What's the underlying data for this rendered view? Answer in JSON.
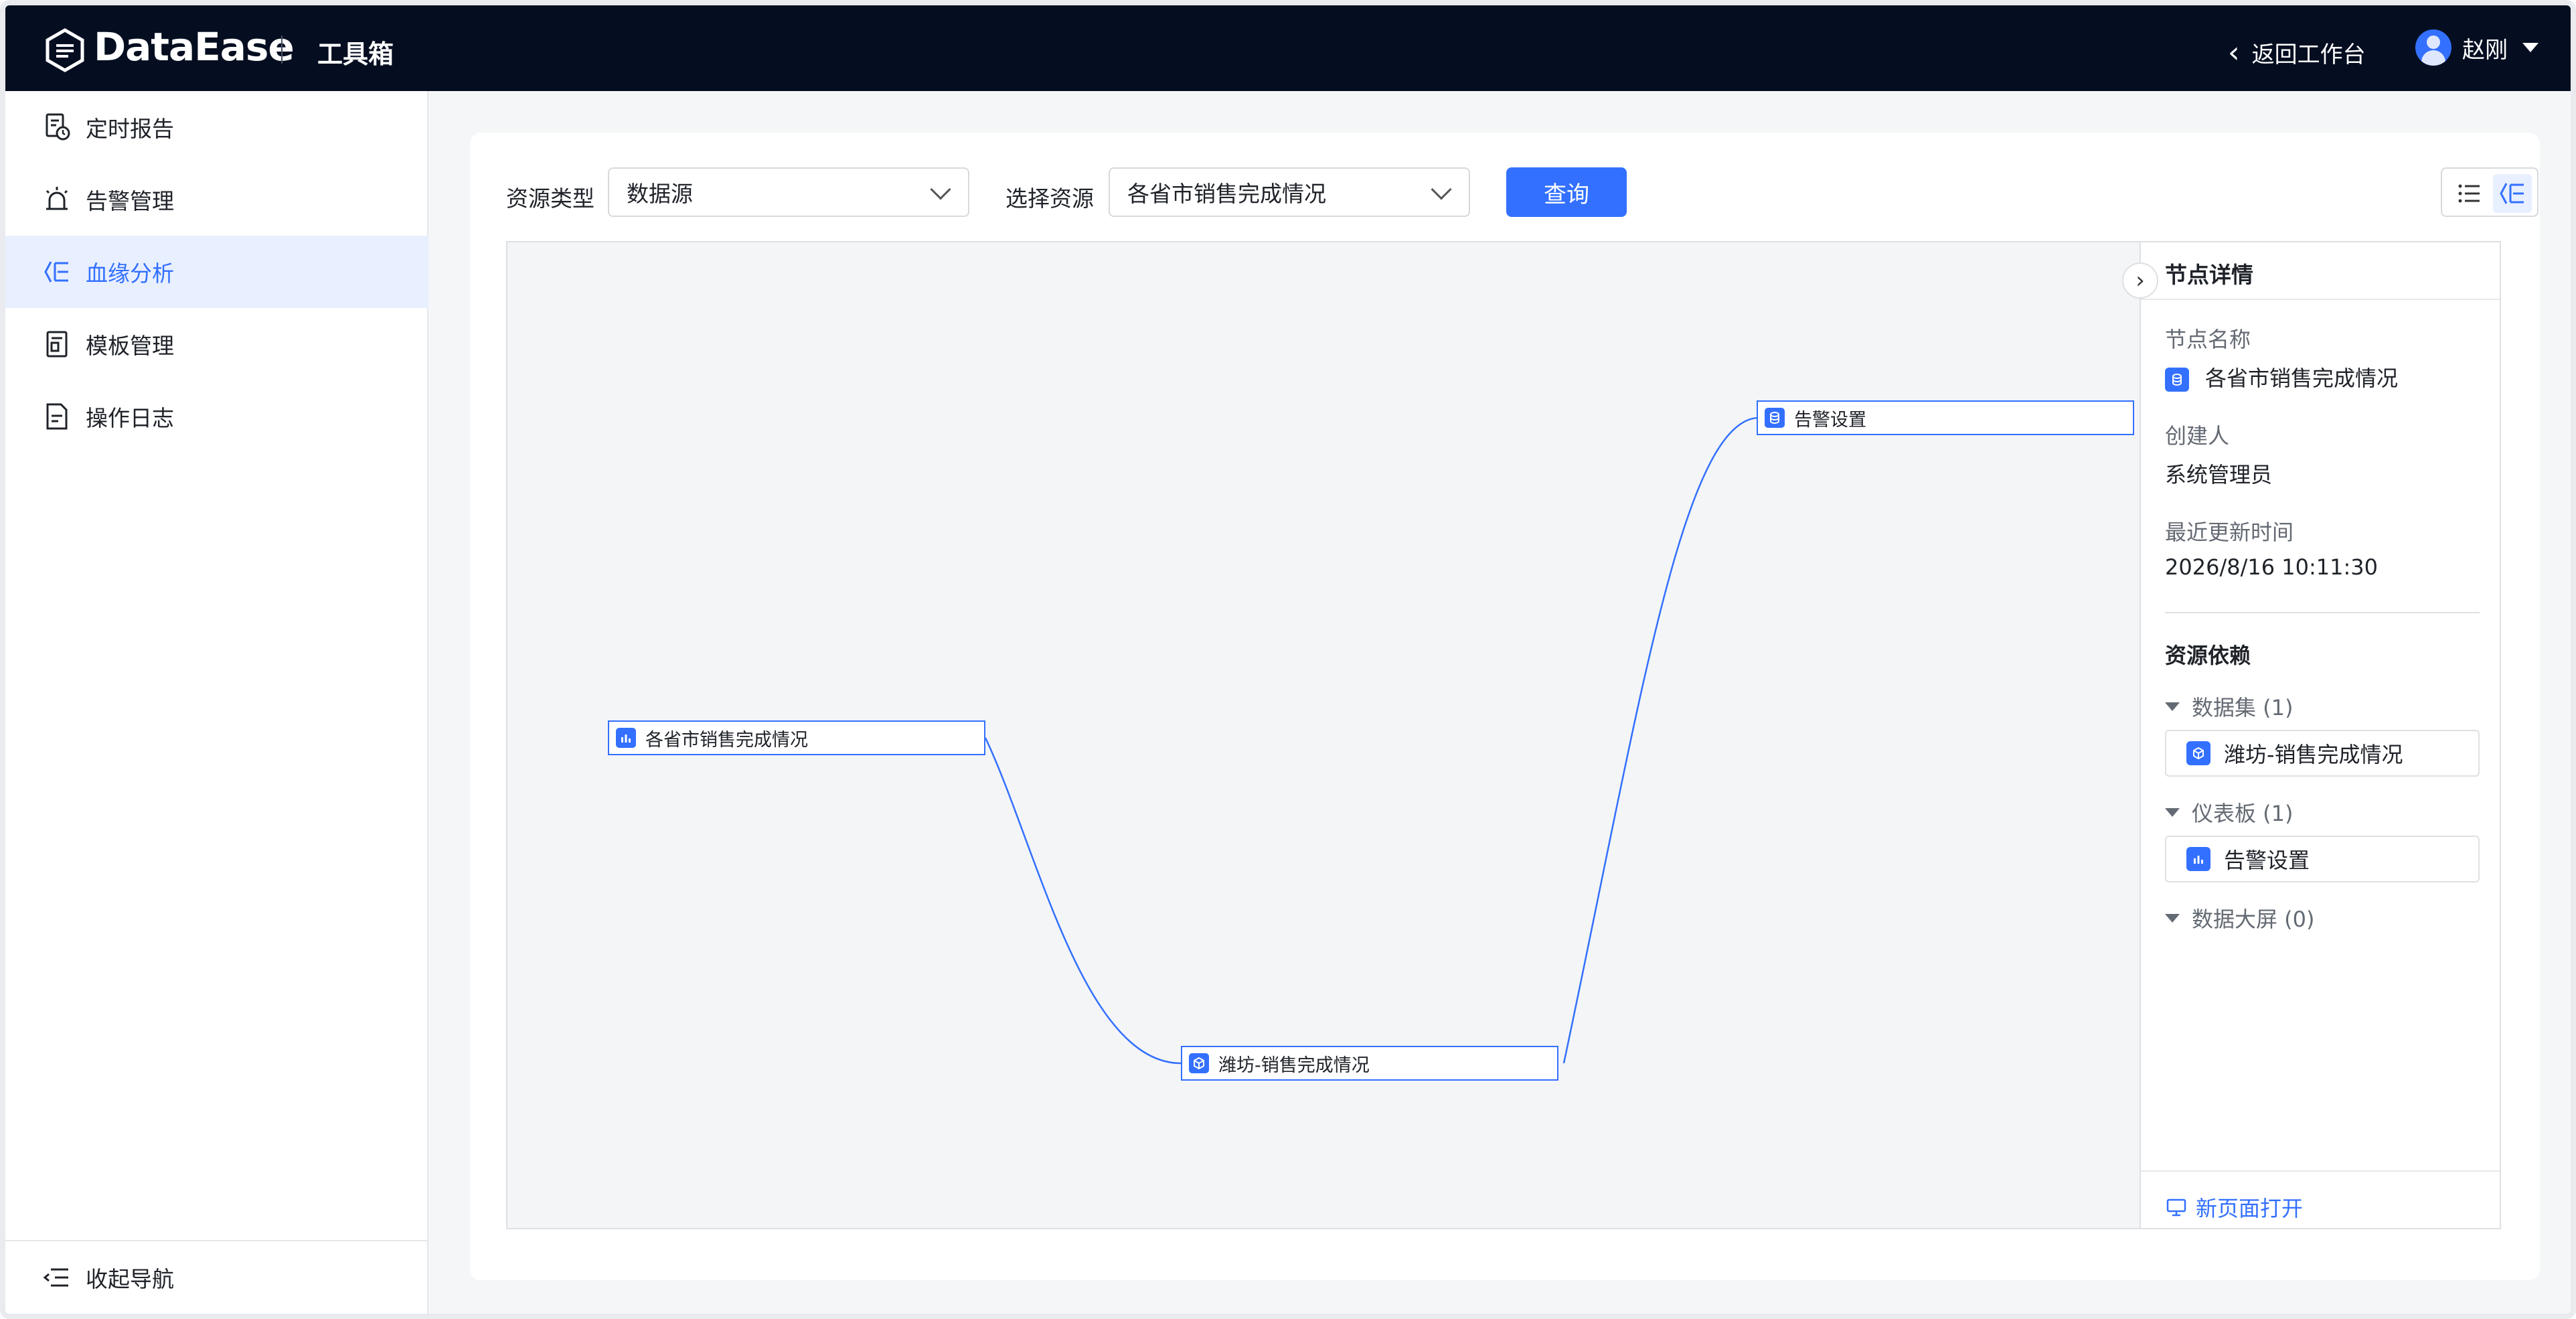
{
  "header": {
    "brand": "DataEase",
    "section": "工具箱",
    "back_label": "返回工作台",
    "user_name": "赵刚"
  },
  "sidebar": {
    "items": [
      {
        "label": "定时报告",
        "icon": "scheduled-report-icon",
        "active": false
      },
      {
        "label": "告警管理",
        "icon": "alarm-icon",
        "active": false
      },
      {
        "label": "血缘分析",
        "icon": "lineage-icon",
        "active": true
      },
      {
        "label": "模板管理",
        "icon": "template-icon",
        "active": false
      },
      {
        "label": "操作日志",
        "icon": "log-icon",
        "active": false
      }
    ],
    "collapse_label": "收起导航"
  },
  "filters": {
    "resource_type_label": "资源类型",
    "resource_type_value": "数据源",
    "resource_label": "选择资源",
    "resource_value": "各省市销售完成情况",
    "query_label": "查询"
  },
  "graph": {
    "nodes": [
      {
        "id": "src",
        "label": "各省市销售完成情况",
        "kind": "datasource"
      },
      {
        "id": "ds",
        "label": "潍坊-销售完成情况",
        "kind": "dataset"
      },
      {
        "id": "dash",
        "label": "告警设置",
        "kind": "dashboard"
      }
    ]
  },
  "panel": {
    "title": "节点详情",
    "name_label": "节点名称",
    "name_value": "各省市销售完成情况",
    "creator_label": "创建人",
    "creator_value": "系统管理员",
    "updated_label": "最近更新时间",
    "updated_value": "2026/8/16 10:11:30",
    "deps_title": "资源依赖",
    "groups": {
      "dataset": {
        "label": "数据集 (1)",
        "item": "潍坊-销售完成情况"
      },
      "dashboard": {
        "label": "仪表板 (1)",
        "item": "告警设置"
      },
      "screen": {
        "label": "数据大屏 (0)"
      }
    },
    "open_new": "新页面打开"
  },
  "colors": {
    "accent": "#3370ff",
    "topbar": "#050e21",
    "active_bg": "#e8efff"
  }
}
